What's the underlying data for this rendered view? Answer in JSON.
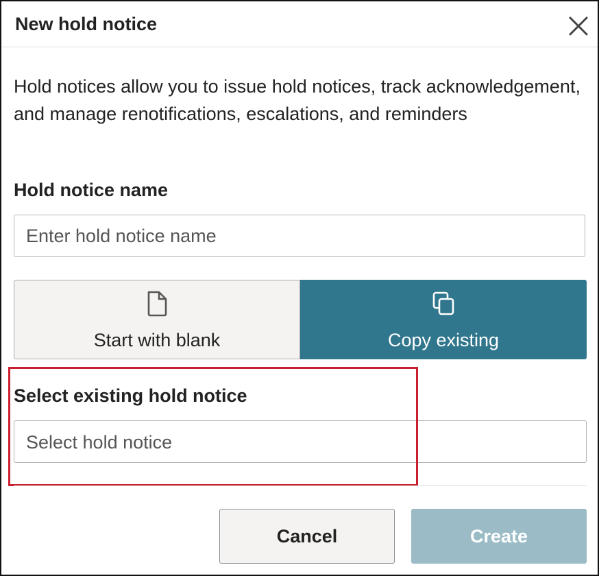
{
  "dialog": {
    "title": "New hold notice",
    "close_icon": "close-icon",
    "description": "Hold notices allow you to issue hold notices, track acknowledgement, and manage renotifications, escalations, and reminders"
  },
  "name_field": {
    "label": "Hold notice name",
    "value": "",
    "placeholder": "Enter hold notice name"
  },
  "start_options": {
    "blank": {
      "label": "Start with blank",
      "icon": "document-icon",
      "selected": false
    },
    "copy": {
      "label": "Copy existing",
      "icon": "copy-icon",
      "selected": true
    }
  },
  "select_field": {
    "label": "Select existing hold notice",
    "placeholder": "Select hold notice",
    "value": ""
  },
  "footer": {
    "cancel_label": "Cancel",
    "create_label": "Create"
  },
  "colors": {
    "accent": "#30768d",
    "create_disabled": "#9bbcc6",
    "highlight": "#cc1f2d"
  }
}
